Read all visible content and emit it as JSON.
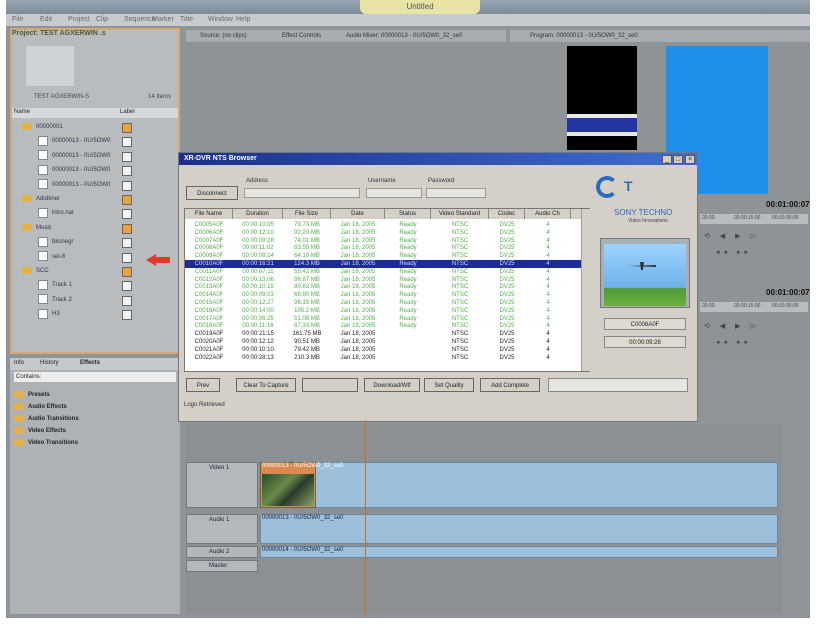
{
  "app": {
    "title": "Untitled",
    "menu": [
      "File",
      "Edit",
      "Project",
      "Clip",
      "Sequence",
      "Marker",
      "Title",
      "Window",
      "Help"
    ]
  },
  "project_panel": {
    "tab": "Project: TEST AGXERWIN .s",
    "name": "TEST AGXERWIN-S",
    "count": "14 Items",
    "columns": [
      "Name",
      "Label"
    ],
    "items": [
      {
        "icon": "folder-icon",
        "label": "00000001",
        "label_color": "orange"
      },
      {
        "icon": "clip-icon",
        "label": "00000013 - 0U/5OW0",
        "label_color": "none"
      },
      {
        "icon": "clip-icon",
        "label": "00000013 - 0U/5OW0",
        "label_color": "none"
      },
      {
        "icon": "audio-icon",
        "label": "00000013 - 0U/5OW0",
        "label_color": "none"
      },
      {
        "icon": "audio-icon",
        "label": "00000013 - 0U/5OW0",
        "label_color": "none"
      },
      {
        "icon": "folder-icon",
        "label": "Adobiner",
        "label_color": "orange"
      },
      {
        "icon": "clip-icon",
        "label": "intro.nar",
        "label_color": "none"
      },
      {
        "icon": "folder-icon",
        "label": "Music",
        "label_color": "orange"
      },
      {
        "icon": "clip-icon",
        "label": "bkcnegr",
        "label_color": "none"
      },
      {
        "icon": "clip-icon",
        "label": "sel-8",
        "label_color": "none"
      },
      {
        "icon": "folder-icon",
        "label": "SCC",
        "label_color": "orange"
      },
      {
        "icon": "clip-icon",
        "label": "Track 1",
        "label_color": "none"
      },
      {
        "icon": "clip-icon",
        "label": "Track 2",
        "label_color": "none"
      },
      {
        "icon": "clip-icon",
        "label": "H3",
        "label_color": "none"
      }
    ]
  },
  "effects_panel": {
    "tabs": [
      "Info",
      "History",
      "Effects"
    ],
    "search_label": "Contains:",
    "folders": [
      "Presets",
      "Audio Effects",
      "Audio Transitions",
      "Video Effects",
      "Video Transitions"
    ]
  },
  "source_monitor": {
    "tabs": [
      "Source: (no clips)",
      "Effect Controls",
      "Audio Mixer: 00000013 - 0U/5OW0_32_se0"
    ]
  },
  "program_monitor": {
    "tab": "Program: 00000013 - 0U/5OW0_32_se0",
    "timecode1": "00:01:00:07",
    "timecode2": "00:01:00:07",
    "ruler1": [
      "00:00",
      "00:00:15:00",
      "00:00:30:00"
    ],
    "ruler2": [
      "00:00",
      "00:00:15:00",
      "00:00:30:00"
    ]
  },
  "dialog": {
    "title": "XR-DVR NTS Browser",
    "connect_label": "Disconnect",
    "address_label": "Address",
    "username_label": "Username",
    "password_label": "Password",
    "logo_text": "SONY TECHNO",
    "logo_sub": "Video Innovations",
    "columns": [
      "File Name",
      "Duration",
      "File Size",
      "Date",
      "Status",
      "Video Standard",
      "Codec",
      "Audio Ch"
    ],
    "rows": [
      {
        "style": "green",
        "cells": [
          "C0005A0F",
          "00:00:10:05",
          "79.73 MB",
          "Jan 18, 2005",
          "Ready",
          "NTSC",
          "DV25",
          "4"
        ]
      },
      {
        "style": "green",
        "cells": [
          "C0006A0F",
          "00:00:12:10",
          "92.20 MB",
          "Jan 18, 2005",
          "Ready",
          "NTSC",
          "DV25",
          "4"
        ]
      },
      {
        "style": "green",
        "cells": [
          "C0007A0F",
          "00:00:09:28",
          "74.01 MB",
          "Jan 18, 2005",
          "Ready",
          "NTSC",
          "DV25",
          "4"
        ]
      },
      {
        "style": "green",
        "cells": [
          "C0008A0F",
          "00:00:11:02",
          "83.55 MB",
          "Jan 18, 2005",
          "Ready",
          "NTSC",
          "DV25",
          "4"
        ]
      },
      {
        "style": "green",
        "cells": [
          "C0009A0F",
          "00:00:08:14",
          "64.10 MB",
          "Jan 18, 2005",
          "Ready",
          "NTSC",
          "DV25",
          "4"
        ]
      },
      {
        "style": "selected",
        "cells": [
          "C0010A0F",
          "00:00:16:21",
          "124.3 MB",
          "Jan 18, 2005",
          "Ready",
          "NTSC",
          "DV25",
          "4"
        ]
      },
      {
        "style": "green",
        "cells": [
          "C0011A0F",
          "00:00:07:11",
          "55.42 MB",
          "Jan 18, 2005",
          "Ready",
          "NTSC",
          "DV25",
          "4"
        ]
      },
      {
        "style": "green",
        "cells": [
          "C0012A0F",
          "00:00:13:06",
          "98.87 MB",
          "Jan 18, 2005",
          "Ready",
          "NTSC",
          "DV25",
          "4"
        ]
      },
      {
        "style": "green",
        "cells": [
          "C0013A0F",
          "00:00:10:19",
          "80.62 MB",
          "Jan 18, 2005",
          "Ready",
          "NTSC",
          "DV25",
          "4"
        ]
      },
      {
        "style": "green",
        "cells": [
          "C0014A0F",
          "00:00:09:03",
          "68.90 MB",
          "Jan 18, 2005",
          "Ready",
          "NTSC",
          "DV25",
          "4"
        ]
      },
      {
        "style": "green",
        "cells": [
          "C0015A0F",
          "00:00:12:27",
          "96.15 MB",
          "Jan 18, 2005",
          "Ready",
          "NTSC",
          "DV25",
          "4"
        ]
      },
      {
        "style": "green",
        "cells": [
          "C0016A0F",
          "00:00:14:00",
          "105.2 MB",
          "Jan 18, 2005",
          "Ready",
          "NTSC",
          "DV25",
          "4"
        ]
      },
      {
        "style": "green",
        "cells": [
          "C0017A0F",
          "00:00:06:25",
          "51.08 MB",
          "Jan 18, 2005",
          "Ready",
          "NTSC",
          "DV25",
          "4"
        ]
      },
      {
        "style": "green",
        "cells": [
          "C0018A0F",
          "00:00:11:16",
          "87.33 MB",
          "Jan 18, 2005",
          "Ready",
          "NTSC",
          "DV25",
          "4"
        ]
      },
      {
        "style": "black",
        "cells": [
          "C0019A0F",
          "00:00:21:15",
          "161.75 MB",
          "Jan 18, 2005",
          "",
          "NTSC",
          "DV25",
          "4"
        ]
      },
      {
        "style": "black",
        "cells": [
          "C0020A0F",
          "00:00:12:12",
          "90.51 MB",
          "Jan 18, 2005",
          "",
          "NTSC",
          "DV25",
          "4"
        ]
      },
      {
        "style": "black",
        "cells": [
          "C0021A0F",
          "00:00:10:10",
          "79.42 MB",
          "Jan 18, 2005",
          "",
          "NTSC",
          "DV25",
          "4"
        ]
      },
      {
        "style": "black",
        "cells": [
          "C0022A0F",
          "00:00:28:13",
          "210.3 MB",
          "Jan 18, 2005",
          "",
          "NTSC",
          "DV25",
          "4"
        ]
      }
    ],
    "buttons": [
      "Prev",
      "Clear To Capture",
      "",
      "Download/Wtf",
      "Set Quality",
      "Add Complete"
    ],
    "status_input": "",
    "status_line": "Logo Retrieved",
    "preview_field1": "C0006A0F",
    "preview_field2": "00:00:09:28"
  },
  "timeline": {
    "tracks": [
      {
        "name": "Video 1",
        "clip_label": "00000013 - 0U/5OW0_32_se0"
      },
      {
        "name": "Audio 1",
        "clip_label": "00000013 - 0U/5OW0_32_se0"
      },
      {
        "name": "Audio 2",
        "clip_label": "00000014 - 0U/5OW0_32_se0"
      },
      {
        "name": "Master",
        "clip_label": ""
      }
    ]
  },
  "colors": {
    "accent": "#1d2a9a",
    "ready_green": "#4fb04a",
    "panel_orange": "#d8a870",
    "arrow_red": "#e23a2a"
  }
}
